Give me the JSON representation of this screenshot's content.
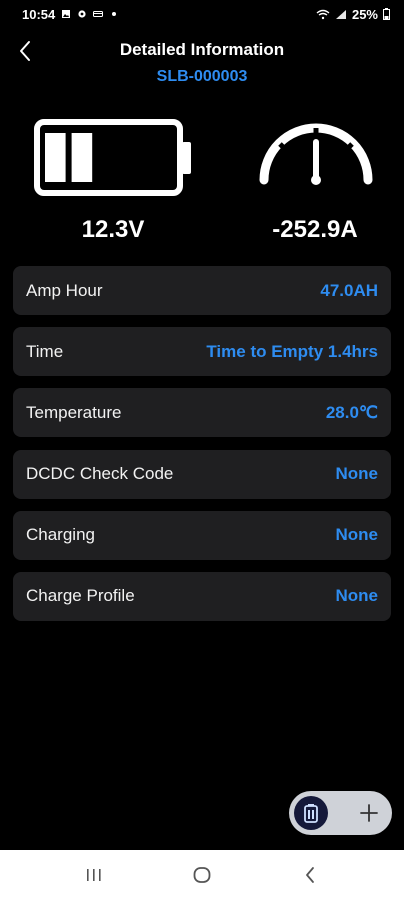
{
  "status_bar": {
    "time": "10:54",
    "battery_percent": "25%",
    "icons": [
      "gallery-icon",
      "settings-icon",
      "card-icon",
      "dot-icon",
      "wifi-icon",
      "signal-icon",
      "battery-icon"
    ]
  },
  "header": {
    "back_icon": "chevron-left-icon",
    "title": "Detailed Information",
    "device_id": "SLB-000003"
  },
  "readings": {
    "voltage": "12.3V",
    "current": "-252.9A",
    "battery_level_fraction": 0.4
  },
  "info_rows": [
    {
      "label": "Amp Hour",
      "value": "47.0AH"
    },
    {
      "label": "Time",
      "value": "Time to Empty 1.4hrs"
    },
    {
      "label": "Temperature",
      "value": "28.0℃"
    },
    {
      "label": "DCDC Check Code",
      "value": "None"
    },
    {
      "label": "Charging",
      "value": "None"
    },
    {
      "label": "Charge Profile",
      "value": "None"
    }
  ],
  "fab": {
    "battery_icon": "battery-icon",
    "plus_icon": "plus-icon"
  },
  "nav_bar": {
    "items": [
      "recent-apps-icon",
      "home-icon",
      "back-icon"
    ]
  },
  "colors": {
    "accent": "#2e8cf0",
    "row_bg": "#1f1f21",
    "background": "#000000",
    "fab_bg": "#cfd2d8",
    "fab_active": "#15193a"
  }
}
